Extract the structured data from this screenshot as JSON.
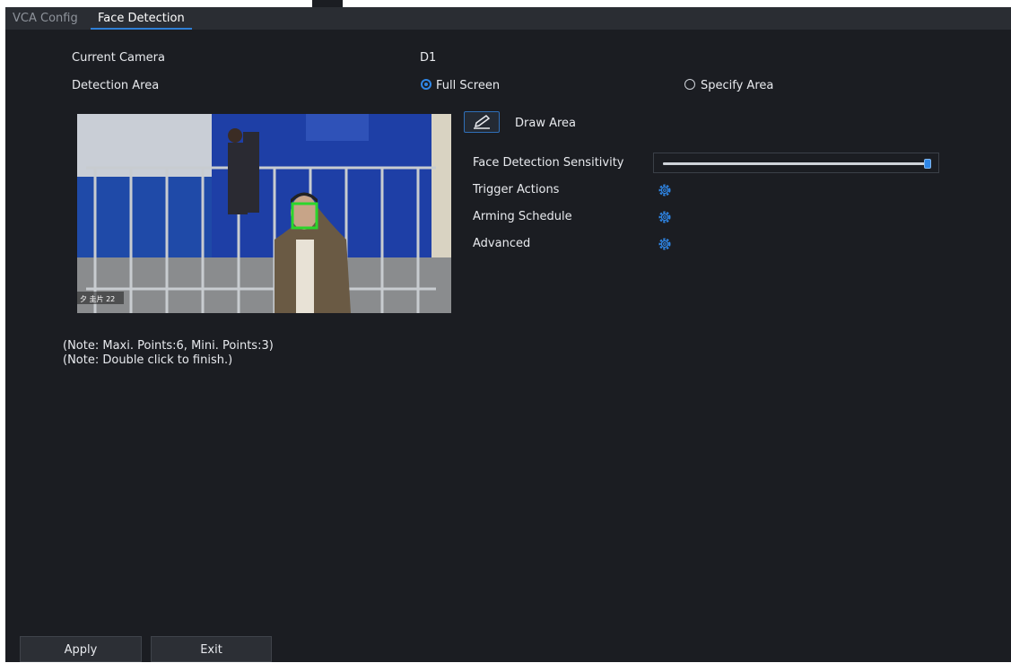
{
  "tabs": [
    {
      "label": "VCA Config",
      "active": false
    },
    {
      "label": "Face Detection",
      "active": true
    }
  ],
  "form": {
    "current_camera_label": "Current Camera",
    "current_camera_value": "D1",
    "detection_area_label": "Detection Area",
    "options": [
      {
        "label": "Full Screen",
        "checked": true
      },
      {
        "label": "Specify Area",
        "checked": false
      }
    ],
    "draw_area_label": "Draw Area",
    "sensitivity_label": "Face Detection Sensitivity",
    "sensitivity_fraction": 1.0,
    "settings": [
      {
        "label": "Trigger Actions",
        "icon": "gear-icon"
      },
      {
        "label": "Arming Schedule",
        "icon": "gear-icon"
      },
      {
        "label": "Advanced",
        "icon": "gear-icon"
      }
    ]
  },
  "preview": {
    "osd_text": "夕 圭片 22"
  },
  "notes": [
    "(Note: Maxi. Points:6, Mini. Points:3)",
    "(Note: Double click to finish.)"
  ],
  "buttons": {
    "apply": "Apply",
    "exit": "Exit"
  },
  "colors": {
    "accent": "#2f86e6",
    "face_box": "#2bd62b",
    "background": "#1b1d22"
  }
}
